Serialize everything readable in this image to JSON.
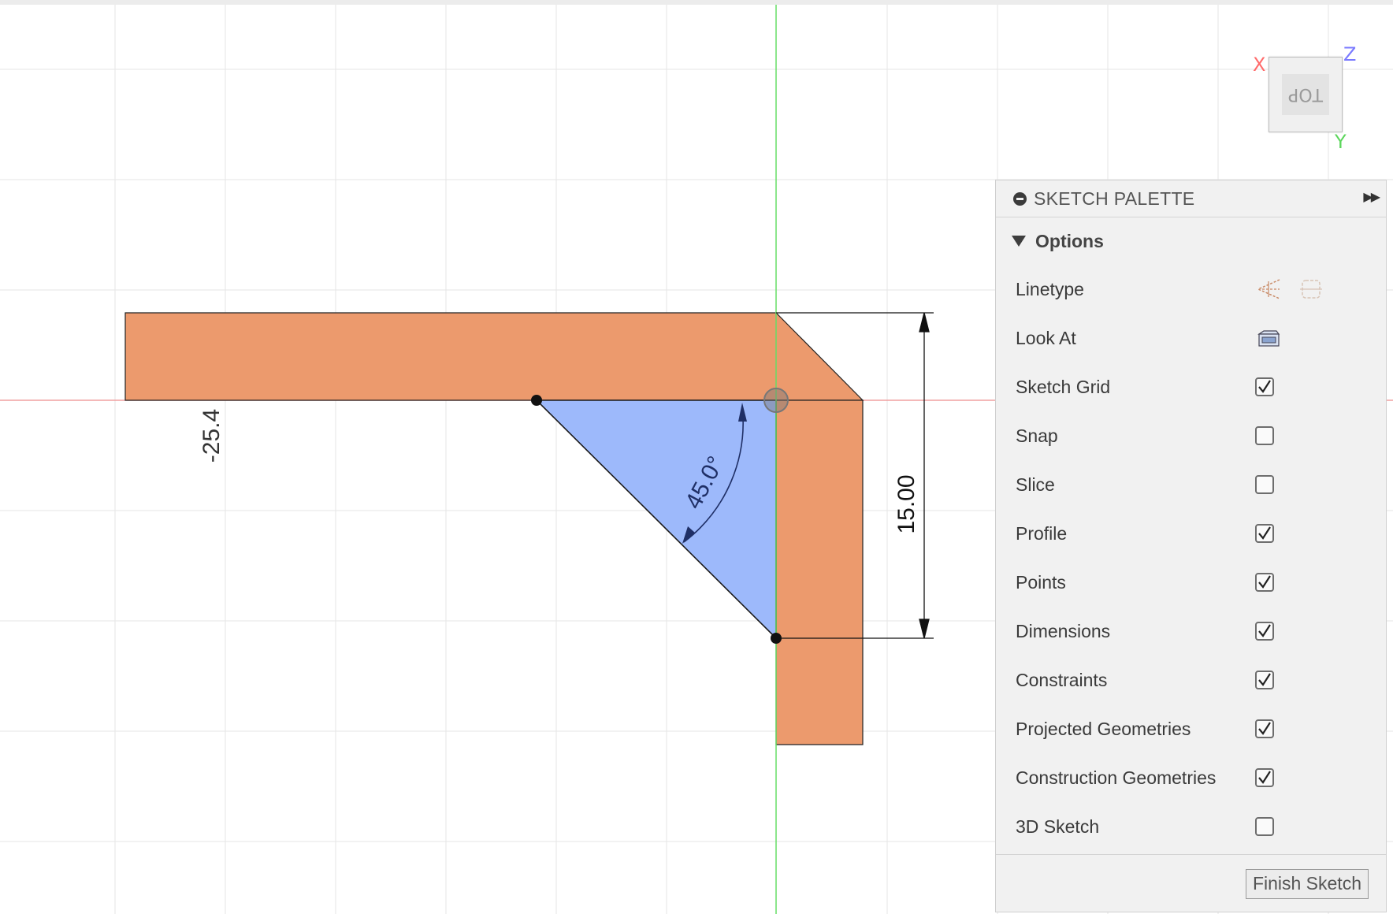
{
  "viewport": {
    "dimensions": {
      "horizontal": "-25.4",
      "vertical": "15.00",
      "angle": "45.0°"
    },
    "colors": {
      "profile_fill": "#ec9a6d",
      "selection_fill": "#9db9fb",
      "grid": "#e6e6e6",
      "x_axis": "#f0a0a0",
      "y_axis": "#66dd66"
    }
  },
  "viewcube": {
    "face": "TOP",
    "axes": {
      "x": "X",
      "y": "Y",
      "z": "Z"
    },
    "axis_colors": {
      "x": "#ff6b6b",
      "y": "#5cd65c",
      "z": "#7a7aff"
    }
  },
  "palette": {
    "title": "SKETCH PALETTE",
    "icons": {
      "collapse": "minus-circle-icon",
      "expand": "double-arrow-right-icon"
    },
    "section": "Options",
    "rows": [
      {
        "label": "Linetype",
        "type": "icons",
        "icons": [
          "construction-line-icon",
          "centerline-icon"
        ]
      },
      {
        "label": "Look At",
        "type": "icon",
        "icons": [
          "look-at-icon"
        ]
      },
      {
        "label": "Sketch Grid",
        "type": "checkbox",
        "checked": true
      },
      {
        "label": "Snap",
        "type": "checkbox",
        "checked": false
      },
      {
        "label": "Slice",
        "type": "checkbox",
        "checked": false
      },
      {
        "label": "Profile",
        "type": "checkbox",
        "checked": true
      },
      {
        "label": "Points",
        "type": "checkbox",
        "checked": true
      },
      {
        "label": "Dimensions",
        "type": "checkbox",
        "checked": true
      },
      {
        "label": "Constraints",
        "type": "checkbox",
        "checked": true
      },
      {
        "label": "Projected Geometries",
        "type": "checkbox",
        "checked": true
      },
      {
        "label": "Construction Geometries",
        "type": "checkbox",
        "checked": true
      },
      {
        "label": "3D Sketch",
        "type": "checkbox",
        "checked": false
      }
    ],
    "finish_label": "Finish Sketch"
  }
}
